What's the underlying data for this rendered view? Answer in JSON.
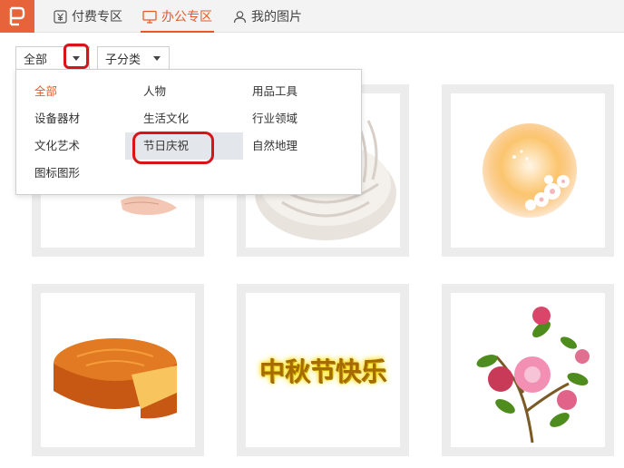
{
  "topbar": {
    "tabs": [
      {
        "label": "付费专区",
        "icon": "yen-icon",
        "active": false
      },
      {
        "label": "办公专区",
        "icon": "monitor-icon",
        "active": true
      },
      {
        "label": "我的图片",
        "icon": "user-icon",
        "active": false
      }
    ]
  },
  "filters": {
    "category_value": "全部",
    "subcategory_value": "子分类"
  },
  "dropdown": {
    "items": [
      "全部",
      "人物",
      "用品工具",
      "设备器材",
      "生活文化",
      "行业领域",
      "文化艺术",
      "节日庆祝",
      "自然地理",
      "图标图形"
    ],
    "active_item": "全部",
    "hovered_item": "节日庆祝"
  },
  "grid": {
    "images": [
      {
        "name": "figure-hand-image"
      },
      {
        "name": "white-mooncake-image"
      },
      {
        "name": "orange-flower-orb-image"
      },
      {
        "name": "mooncake-image"
      },
      {
        "name": "mid-autumn-text-image",
        "text": "中秋节快乐"
      },
      {
        "name": "peony-flowers-image"
      }
    ]
  },
  "colors": {
    "accent": "#e35b2b",
    "logo_bg": "#e7643a",
    "annotation_red": "#d8141a",
    "hover_bg": "#e3e6ea"
  }
}
